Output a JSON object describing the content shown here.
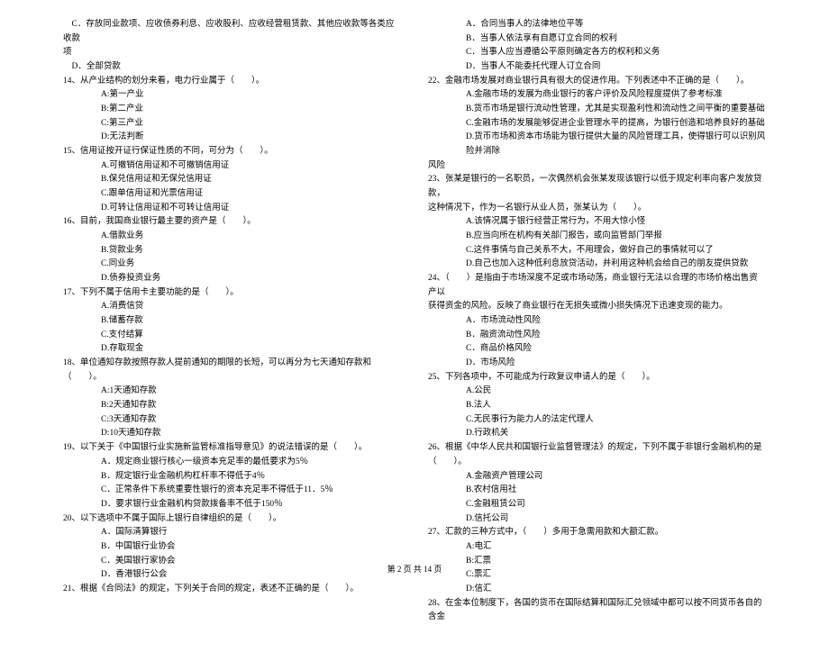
{
  "footer": "第 2 页 共 14 页",
  "left": {
    "l0": "    C．存放同业款项、应收债券利息、应收股利、应收经营租赁款、其他应收款等各类应收款",
    "l1": "项",
    "l2": "    D．全部贷款",
    "q14": "14、从产业结构的划分来看，电力行业属于（　　）。",
    "q14a": "A:第一产业",
    "q14b": "B:第二产业",
    "q14c": "C:第三产业",
    "q14d": "D:无法判断",
    "q15": "15、信用证按开证行保证性质的不同，可分为（　　）。",
    "q15a": "A.可撤销信用证和不可撤销信用证",
    "q15b": "B.保兑信用证和无保兑信用证",
    "q15c": "C.跟单信用证和光票信用证",
    "q15d": "D.可转让信用证和不可转让信用证",
    "q16": "16、目前，我国商业银行最主要的资产是（　　）。",
    "q16a": "A.借款业务",
    "q16b": "B.贷款业务",
    "q16c": "C.同业务",
    "q16d": "D.债券投资业务",
    "q17": "17、下列不属于信用卡主要功能的是（　　）。",
    "q17a": "A.消费信贷",
    "q17b": "B.储蓄存款",
    "q17c": "C.支付结算",
    "q17d": "D.存取现金",
    "q18": "18、单位通知存款按照存款人提前通知的期限的长短，可以再分为七天通知存款和（　　）。",
    "q18a": "A:1天通知存款",
    "q18b": "B:2天通知存款",
    "q18c": "C:3天通知存款",
    "q18d": "D:10天通知存款",
    "q19": "19、以下关于《中国银行业实施新监管标准指导意见》的说法错误的是（　　）。",
    "q19a": "A．规定商业银行核心一级资本充足率的最低要求为5％",
    "q19b": "B．规定银行业金融机构杠杆率不得低于4％",
    "q19c": "C．正常条件下系统重要性银行的资本充足率不得低于11．5％",
    "q19d": "D．要求银行业金融机构贷款拨备率不低于150％",
    "q20": "20、以下选项中不属于国际上银行自律组织的是（　　）。",
    "q20a": "A．国际清算银行",
    "q20b": "B．中国银行业协会",
    "q20c": "C．美国银行家协会",
    "q20d": "D．香港银行公会",
    "q21": "21、根据《合同法》的规定，下列关于合同的规定，表述不正确的是（　　）。"
  },
  "right": {
    "q21a": "A．合同当事人的法律地位平等",
    "q21b": "B．当事人依法享有自愿订立合同的权利",
    "q21c": "C．当事人应当遵循公平原则确定各方的权利和义务",
    "q21d": "D．当事人不能委托代理人订立合同",
    "q22": "22、金融市场发展对商业银行具有很大的促进作用。下列表述中不正确的是（　　）。",
    "q22a": "A.金融市场的发展为商业银行的客户评价及风险程度提供了参考标准",
    "q22b": "B.货币市场是银行流动性管理，尤其是实现盈利性和流动性之间平衡的重要基础",
    "q22c": "C.金融市场的发展能够促进企业管理水平的提高，为银行创造和培养良好的基础",
    "q22d": "D.货币市场和资本市场能为银行提供大量的风险管理工具，使得银行可以识别风险并消除",
    "q22e": "风险",
    "q23": "23、张某是银行的一名职员，一次偶然机会张某发现该银行以低于规定利率向客户发放贷款，",
    "q23x": "这种情况下，作为一名银行从业人员，张某认为（　　）。",
    "q23a": "A.该情况属于银行经营正常行为，不用大惊小怪",
    "q23b": "B.应当向所在机构有关部门报告，或向监管部门举报",
    "q23c": "C.这件事情与自己关系不大，不用理会，做好自己的事情就可以了",
    "q23d": "D.自己也加入这种低利息放贷活动，并利用这种机会给自己的朋友提供贷款",
    "q24": "24、（　　）是指由于市场深度不足或市场动荡，商业银行无法以合理的市场价格出售资产以",
    "q24x": "获得资金的风险。反映了商业银行在无损失或微小损失情况下迅速变现的能力。",
    "q24a": "A．市场流动性风险",
    "q24b": "B．融资流动性风险",
    "q24c": "C．商品价格风险",
    "q24d": "D．市场风险",
    "q25": "25、下列各项中，不可能成为行政复议申请人的是（　　）。",
    "q25a": "A.公民",
    "q25b": "B.法人",
    "q25c": "C.无民事行为能力人的法定代理人",
    "q25d": "D.行政机关",
    "q26": "26、根据《中华人民共和国银行业监督管理法》的规定，下列不属于非银行金融机构的是",
    "q26x": "（　　）。",
    "q26a": "A.金融资产管理公司",
    "q26b": "B.农村信用社",
    "q26c": "C.金融租赁公司",
    "q26d": "D.信托公司",
    "q27": "27、汇款的三种方式中，（　　）多用于急需用款和大额汇款。",
    "q27a": "A:电汇",
    "q27b": "B:汇票",
    "q27c": "C:票汇",
    "q27d": "D:信汇",
    "q28": "28、在金本位制度下，各国的货币在国际结算和国际汇兑领域中都可以按不同货币各自的含金"
  }
}
